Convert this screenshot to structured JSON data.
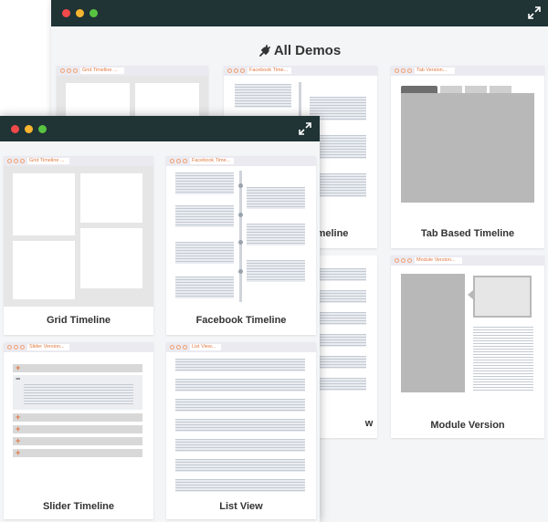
{
  "back_window": {
    "title": "All Demos",
    "cards": [
      {
        "tab": "Grid Timeline ...",
        "label": ""
      },
      {
        "tab": "Facebook Time...",
        "label": "meline"
      },
      {
        "tab": "Tab Version...",
        "label": "Tab Based Timeline"
      },
      {
        "tab": "",
        "label": "w"
      },
      {
        "tab": "Module Version...",
        "label": "Module Version"
      }
    ]
  },
  "front_window": {
    "cards": [
      {
        "tab": "Grid Timeline ...",
        "label": "Grid Timeline"
      },
      {
        "tab": "Facebook Time...",
        "label": "Facebook Timeline"
      },
      {
        "tab": "Slider Version...",
        "label": "Slider Timeline"
      },
      {
        "tab": "List View...",
        "label": "List View"
      }
    ]
  },
  "icons": {
    "title_icon": "plug-icon",
    "expand_icon": "expand-icon",
    "window_controls": [
      "close-dot",
      "minimize-dot",
      "maximize-dot"
    ]
  },
  "colors": {
    "titlebar": "#203335",
    "accent": "#e07840",
    "close": "#f2494a",
    "minimize": "#f7b530",
    "maximize": "#58c340"
  }
}
